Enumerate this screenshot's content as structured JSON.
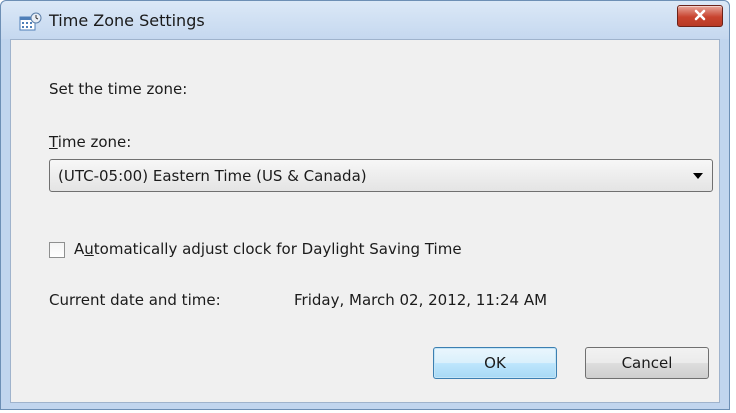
{
  "window": {
    "title": "Time Zone Settings",
    "close_label": "✕"
  },
  "dialog": {
    "prompt": "Set the time zone:",
    "tz_label_prefix": "",
    "tz_label_accel": "T",
    "tz_label_rest": "ime zone:",
    "tz_selected": "(UTC-05:00) Eastern Time (US & Canada)",
    "dst_label_prefix": "A",
    "dst_label_accel": "u",
    "dst_label_rest": "tomatically adjust clock for Daylight Saving Time",
    "dst_checked": false,
    "datetime_label": "Current date and time:",
    "datetime_value": "Friday, March 02, 2012, 11:24 AM"
  },
  "buttons": {
    "ok": "OK",
    "cancel": "Cancel"
  },
  "icons": {
    "app": "calendar-clock-icon",
    "close": "close-icon",
    "dropdown": "chevron-down-icon"
  },
  "colors": {
    "titlebar": "#c5d8ef",
    "close_button": "#c8442f",
    "client_background": "#f0f0f0",
    "default_button_border": "#3c7fb1"
  }
}
